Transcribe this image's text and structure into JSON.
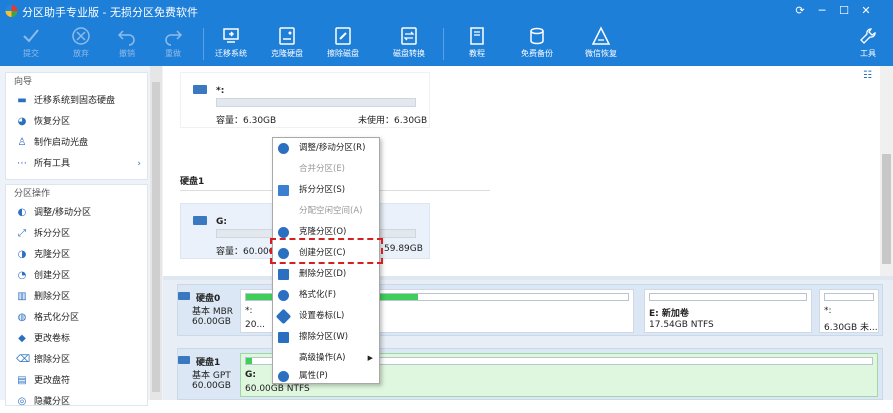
{
  "window": {
    "title": "分区助手专业版 - 无损分区免费软件"
  },
  "toolbar": {
    "items": [
      {
        "label": "提交",
        "disabled": true
      },
      {
        "label": "放弃",
        "disabled": true
      },
      {
        "label": "撤销",
        "disabled": true
      },
      {
        "label": "重做",
        "disabled": true
      },
      {
        "label": "迁移系统",
        "disabled": false
      },
      {
        "label": "克隆硬盘",
        "disabled": false
      },
      {
        "label": "擦除磁盘",
        "disabled": false
      },
      {
        "label": "磁盘转换",
        "disabled": false
      },
      {
        "label": "教程",
        "disabled": false
      },
      {
        "label": "免费备份",
        "disabled": false
      },
      {
        "label": "微信恢复",
        "disabled": false
      },
      {
        "label": "工具",
        "disabled": false
      }
    ]
  },
  "sidebar": {
    "wizard": {
      "title": "向导",
      "items": [
        "迁移系统到固态硬盘",
        "恢复分区",
        "制作启动光盘",
        "所有工具"
      ]
    },
    "partition_ops": {
      "title": "分区操作",
      "items": [
        "调整/移动分区",
        "拆分分区",
        "克隆分区",
        "创建分区",
        "删除分区",
        "格式化分区",
        "更改卷标",
        "擦除分区",
        "更改盘符",
        "隐藏分区"
      ]
    }
  },
  "top_cards": [
    {
      "name": "*:",
      "capacity": "容量：6.30GB",
      "unused": "未使用：6.30GB"
    },
    {
      "name": "G:",
      "capacity": "容量：60.00GB",
      "unused": "59.89GB"
    }
  ],
  "disk1_label": "硬盘1",
  "disks": [
    {
      "name": "硬盘0",
      "type": "基本 MBR",
      "size": "60.00GB",
      "partitions": [
        {
          "name": "*:",
          "size": "20...",
          "fill": 0.45
        },
        {
          "name": "E: 新加卷",
          "size": "17.54GB NTFS",
          "fill": 0.0
        },
        {
          "name": "*:",
          "size": "6.30GB 未...",
          "fill": 0.0
        }
      ]
    },
    {
      "name": "硬盘1",
      "type": "基本 GPT",
      "size": "60.00GB",
      "partitions": [
        {
          "name": "G:",
          "size": "60.00GB NTFS",
          "fill": 0.01
        }
      ]
    }
  ],
  "context_menu": {
    "items": [
      {
        "label": "调整/移动分区(R)",
        "disabled": false
      },
      {
        "label": "合并分区(E)",
        "disabled": true
      },
      {
        "label": "拆分分区(S)",
        "disabled": false
      },
      {
        "label": "分配空闲空间(A)",
        "disabled": true
      },
      {
        "label": "克隆分区(O)",
        "disabled": false
      },
      {
        "label": "创建分区(C)",
        "disabled": false,
        "highlighted": true
      },
      {
        "label": "删除分区(D)",
        "disabled": false
      },
      {
        "label": "格式化(F)",
        "disabled": false
      },
      {
        "label": "设置卷标(L)",
        "disabled": false
      },
      {
        "label": "擦除分区(W)",
        "disabled": false
      },
      {
        "label": "高级操作(A)",
        "disabled": false,
        "submenu": true
      },
      {
        "label": "属性(P)",
        "disabled": false
      }
    ]
  },
  "colors": {
    "accent": "#1e7fd8",
    "used_fill": "#3ecf5a",
    "highlight_border": "#d62020"
  }
}
